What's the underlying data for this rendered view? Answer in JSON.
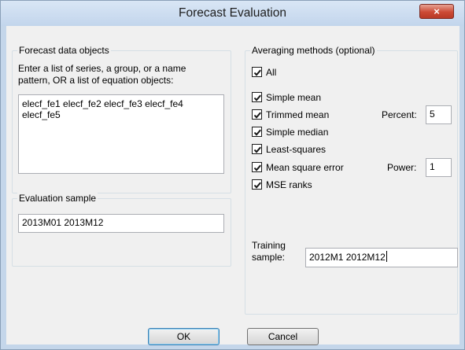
{
  "window": {
    "title": "Forecast Evaluation",
    "close_label": "×"
  },
  "forecast_group": {
    "label": "Forecast data objects",
    "instructions_line1": "Enter a list of series, a group, or a name",
    "instructions_line2": "pattern, OR a list of equation objects:",
    "value_line1": "elecf_fe1 elecf_fe2 elecf_fe3 elecf_fe4",
    "value_line2": "elecf_fe5"
  },
  "evaluation_group": {
    "label": "Evaluation sample",
    "value": "2013M01 2013M12"
  },
  "averaging_group": {
    "label": "Averaging methods (optional)",
    "all_label": "All",
    "all_checked": true,
    "methods": [
      {
        "label": "Simple mean",
        "checked": true
      },
      {
        "label": "Trimmed mean",
        "checked": true
      },
      {
        "label": "Simple median",
        "checked": true
      },
      {
        "label": "Least-squares",
        "checked": true
      },
      {
        "label": "Mean square error",
        "checked": true
      },
      {
        "label": "MSE ranks",
        "checked": true
      }
    ],
    "percent_label": "Percent:",
    "percent_value": "5",
    "power_label": "Power:",
    "power_value": "1",
    "training_label_line1": "Training",
    "training_label_line2": "sample:",
    "training_value": "2012M1 2012M12"
  },
  "buttons": {
    "ok": "OK",
    "cancel": "Cancel"
  }
}
